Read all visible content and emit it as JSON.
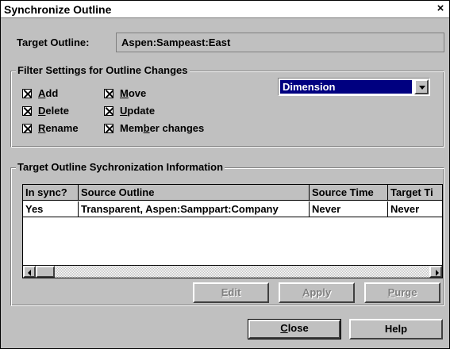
{
  "window": {
    "title": "Synchronize Outline",
    "close_glyph": "×"
  },
  "target": {
    "label": "Target Outline:",
    "value": "Aspen:Sampeast:East"
  },
  "filter": {
    "legend": "Filter Settings for Outline Changes",
    "checkboxes": [
      {
        "pre": "",
        "u": "A",
        "post": "dd",
        "checked": true
      },
      {
        "pre": "",
        "u": "D",
        "post": "elete",
        "checked": true
      },
      {
        "pre": "",
        "u": "R",
        "post": "ename",
        "checked": true
      },
      {
        "pre": "",
        "u": "M",
        "post": "ove",
        "checked": true
      },
      {
        "pre": "",
        "u": "U",
        "post": "pdate",
        "checked": true
      },
      {
        "pre": "Mem",
        "u": "b",
        "post": "er changes",
        "checked": true
      }
    ],
    "dropdown_value": "Dimension"
  },
  "sync": {
    "legend": "Target Outline Sychronization Information",
    "columns": [
      "In sync?",
      "Source Outline",
      "Source Time",
      "Target Ti"
    ],
    "rows": [
      [
        "Yes",
        "Transparent, Aspen:Samppart:Company",
        "Never",
        "Never"
      ]
    ]
  },
  "buttons": {
    "edit": {
      "u": "E",
      "post": "dit"
    },
    "apply": {
      "u": "A",
      "post": "pply"
    },
    "purge": {
      "u": "P",
      "post": "urge"
    },
    "close": {
      "u": "C",
      "post": "lose"
    },
    "help": "Help"
  }
}
